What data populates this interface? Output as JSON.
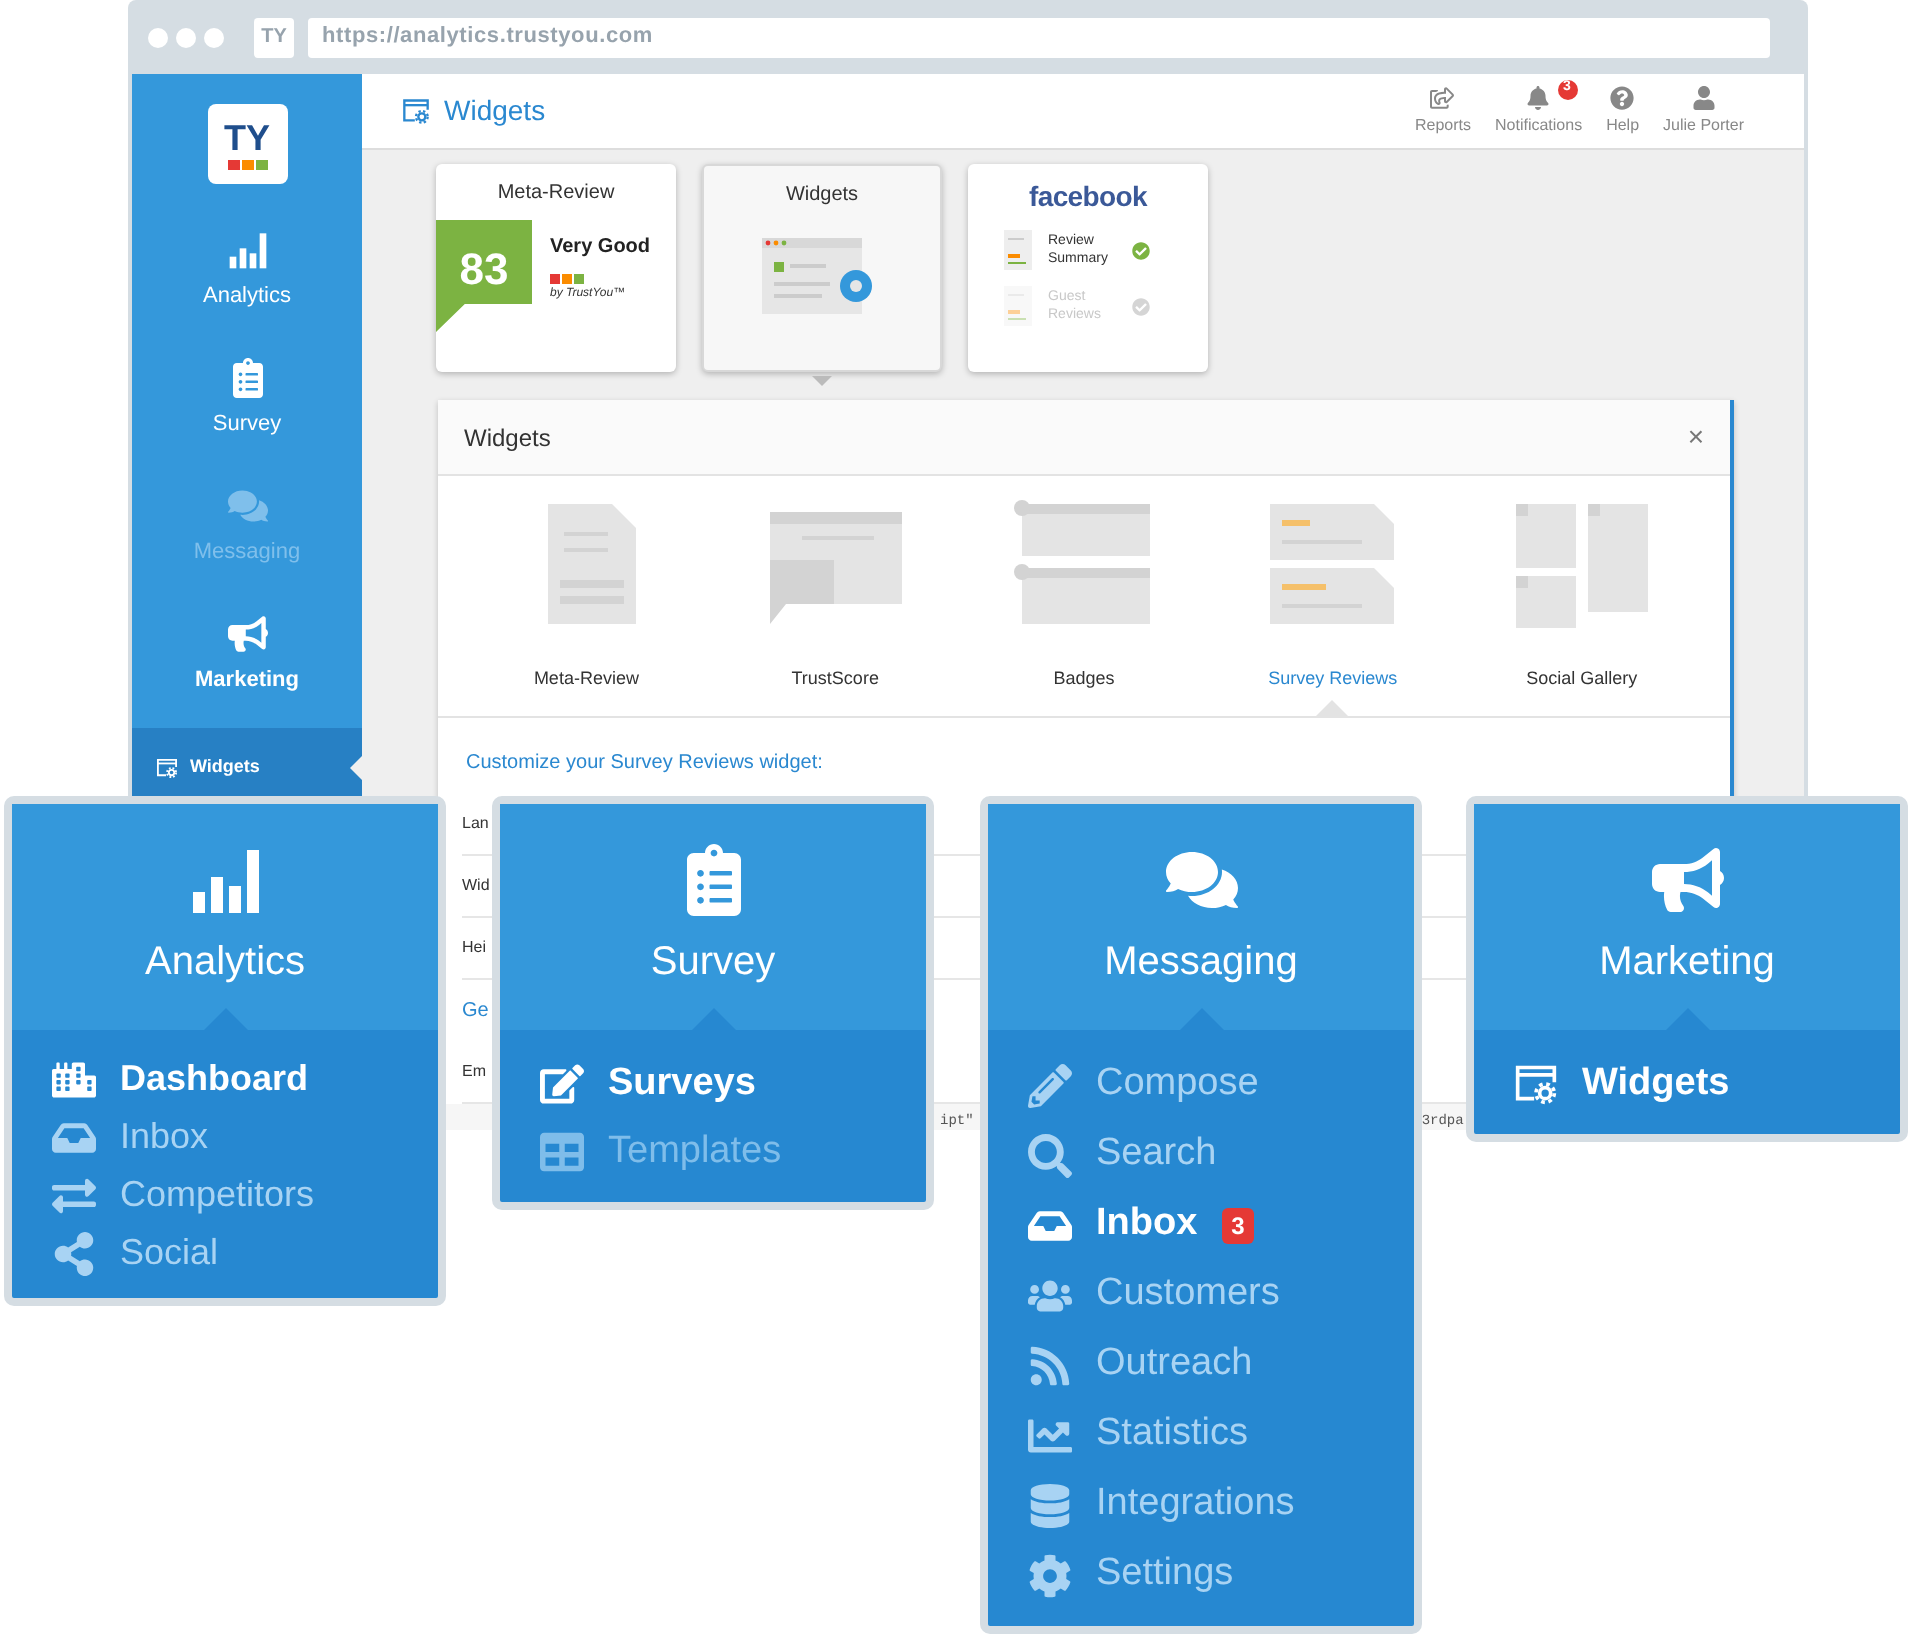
{
  "browser": {
    "favicon": "TY",
    "url": "https://analytics.trustyou.com"
  },
  "sidebar": {
    "logo": "TY",
    "items": [
      {
        "label": "Analytics",
        "selected": false,
        "disabled": false
      },
      {
        "label": "Survey",
        "selected": false,
        "disabled": false
      },
      {
        "label": "Messaging",
        "selected": false,
        "disabled": true
      },
      {
        "label": "Marketing",
        "selected": true,
        "disabled": false
      }
    ],
    "subitems": [
      {
        "label": "Widgets",
        "selected": true
      }
    ]
  },
  "header": {
    "title": "Widgets",
    "actions": [
      {
        "label": "Reports"
      },
      {
        "label": "Notifications",
        "badge": "3"
      },
      {
        "label": "Help"
      },
      {
        "label": "Julie Porter"
      }
    ]
  },
  "cards": [
    {
      "kind": "meta_review",
      "title": "Meta-Review",
      "score": "83",
      "rating": "Very Good",
      "byline": "by TrustYou™",
      "selected": false
    },
    {
      "kind": "widgets",
      "title": "Widgets",
      "selected": true
    },
    {
      "kind": "facebook",
      "title": "facebook",
      "selected": false,
      "rows": [
        {
          "label": "Review Summary",
          "checked": true
        },
        {
          "label": "Guest Reviews",
          "checked": false
        }
      ]
    }
  ],
  "panel": {
    "title": "Widgets",
    "close": "×",
    "tiles": [
      {
        "label": "Meta-Review",
        "selected": false
      },
      {
        "label": "TrustScore",
        "selected": false
      },
      {
        "label": "Badges",
        "selected": false
      },
      {
        "label": "Survey Reviews",
        "selected": true
      },
      {
        "label": "Social Gallery",
        "selected": false
      }
    ],
    "customize": "Customize your Survey Reviews widget:",
    "form_labels": [
      {
        "text": "Lan",
        "kind": "label"
      },
      {
        "text": "Wid",
        "kind": "label"
      },
      {
        "text": "Hei",
        "kind": "label"
      },
      {
        "text": "Ge",
        "kind": "link"
      },
      {
        "text": "Em",
        "kind": "label"
      }
    ],
    "code_fragments": [
      "ipt\"",
      "3rdpa"
    ]
  },
  "menus": [
    {
      "title": "Analytics",
      "items": [
        {
          "label": "Dashboard",
          "selected": true,
          "disabled": false
        },
        {
          "label": "Inbox",
          "selected": false,
          "disabled": false
        },
        {
          "label": "Competitors",
          "selected": false,
          "disabled": false
        },
        {
          "label": "Social",
          "selected": false,
          "disabled": false
        }
      ]
    },
    {
      "title": "Survey",
      "items": [
        {
          "label": "Surveys",
          "selected": true,
          "disabled": false
        },
        {
          "label": "Templates",
          "selected": false,
          "disabled": true
        }
      ]
    },
    {
      "title": "Messaging",
      "items": [
        {
          "label": "Compose",
          "selected": false,
          "disabled": false
        },
        {
          "label": "Search",
          "selected": false,
          "disabled": false
        },
        {
          "label": "Inbox",
          "selected": true,
          "disabled": false,
          "badge": "3"
        },
        {
          "label": "Customers",
          "selected": false,
          "disabled": false
        },
        {
          "label": "Outreach",
          "selected": false,
          "disabled": false
        },
        {
          "label": "Statistics",
          "selected": false,
          "disabled": false
        },
        {
          "label": "Integrations",
          "selected": false,
          "disabled": false
        },
        {
          "label": "Settings",
          "selected": false,
          "disabled": false
        }
      ]
    },
    {
      "title": "Marketing",
      "items": [
        {
          "label": "Widgets",
          "selected": true,
          "disabled": false
        }
      ]
    }
  ]
}
